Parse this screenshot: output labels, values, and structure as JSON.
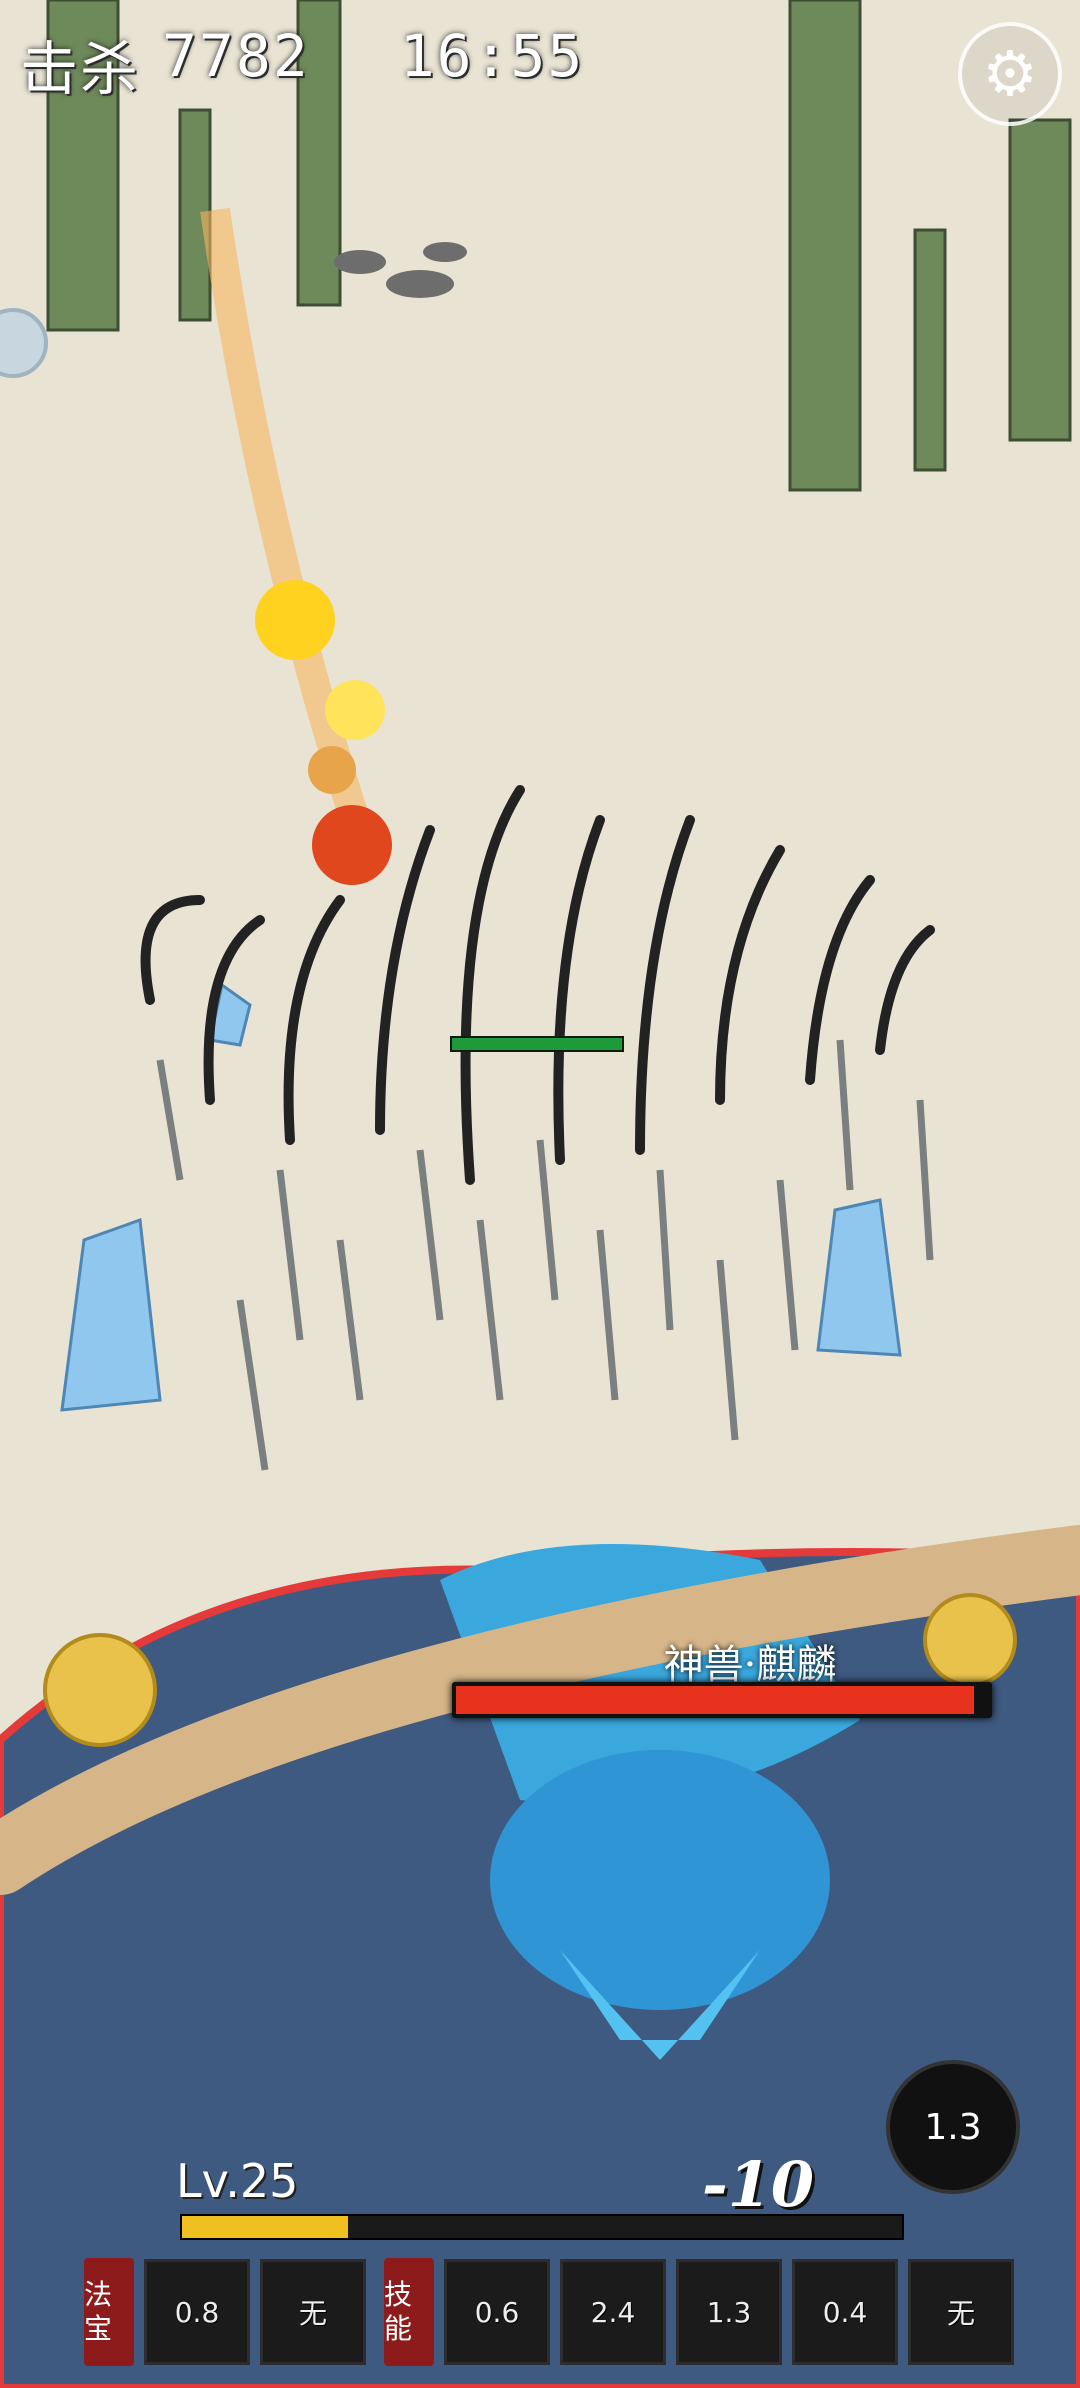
{
  "hud": {
    "kills_label": "击杀",
    "kills_value": "7782",
    "timer": "16:55",
    "settings_icon": "gear-icon"
  },
  "enemy": {
    "hp_fraction": 1.0
  },
  "boss": {
    "name": "神兽·麒麟",
    "hp_fraction": 0.96
  },
  "player": {
    "level": "Lv.25",
    "xp_fraction": 0.23
  },
  "damage_text": "-10",
  "cooldown_indicator": "1.3",
  "skillbar": {
    "treasure_label": "法宝",
    "treasure_slots": [
      "0.8",
      "无"
    ],
    "skills_label": "技能",
    "skill_slots": [
      "0.6",
      "2.4",
      "1.3",
      "0.4",
      "无"
    ]
  },
  "colors": {
    "boss_hp": "#e8321e",
    "xp": "#f0c020",
    "enemy_hp": "#1f9a3a"
  }
}
